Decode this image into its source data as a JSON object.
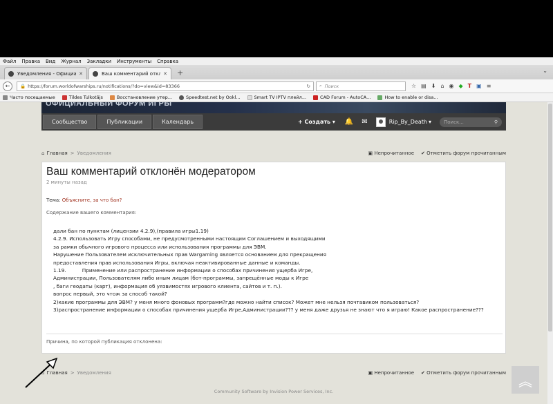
{
  "browser": {
    "menu": [
      "Файл",
      "Правка",
      "Вид",
      "Журнал",
      "Закладки",
      "Инструменты",
      "Справка"
    ],
    "tabs": [
      {
        "label": "Уведомления - Официальный ..."
      },
      {
        "label": "Ваш комментарий отклонё..."
      }
    ],
    "url": "https://forum.worldofwarships.ru/notifications/?do=view&id=83366",
    "search_placeholder": "Поиск",
    "bookmarks": [
      "Часто посещаемые",
      "Tildes Tulkotājs",
      "Восстановление утер...",
      "Speedtest.net by Ookl...",
      "Smart TV IPTV плейл...",
      "CAD Forum - AutoCA...",
      "How to enable or disa..."
    ]
  },
  "site": {
    "banner_title": "ОФИЦИАЛЬНЫЙ ФОРУМ ИГРЫ",
    "nav": [
      "Сообщество",
      "Публикации",
      "Календарь"
    ],
    "create_label": "Создать",
    "username": "Rip_By_Death",
    "search_placeholder": "Поиск..."
  },
  "breadcrumb": {
    "home": "Главная",
    "current": "Уведомления",
    "unread": "Непрочитанное",
    "mark_read": "Отметить форум прочитанным"
  },
  "notification": {
    "title": "Ваш комментарий отклонён модератором",
    "time": "2 минуты назад",
    "topic_label": "Тема:",
    "topic_link": "Объясните, за что бан?",
    "content_label": "Содержание вашего комментария:",
    "body": [
      "дали бан по пунктам (лицензии 4.2.9),(правила игры1.19)",
      "4.2.9. Использовать Игру способами, не предусмотренными настоящим Соглашением и выходящими",
      "за рамки обычного игрового процесса или использования программы для ЭВМ.",
      "Нарушение Пользователем исключительных прав Wargaming является основанием для прекращения",
      "предоставления прав использования Игры, включая неактивированные данные и команды.",
      "1.19.          Применение или распространение информации о способах причинения ущерба Игре,",
      "Администрации, Пользователям либо иным лицам (бот-программы, запрещённые моды к Игре",
      ", баги геодаты (карт), информация об уязвимостях игрового клиента, сайтов и т. п.).",
      "вопрос первый, это чтож за способ такой?",
      "2)какие программы для ЭВМ? у меня много фоновых программ?где можно найти список? Может мне нельзя почтавиком пользоваться?",
      "3)распространение информации о способах причинения ущерба Игре,Администрации??? у меня даже друзья не знают что я играю! Какое распространение???"
    ],
    "reason_label": "Причина, по которой публикация отклонена:"
  },
  "footer": "Community Software by Invision Power Services, Inc."
}
